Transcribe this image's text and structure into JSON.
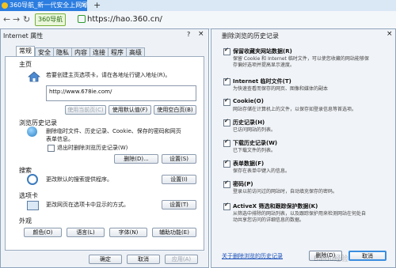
{
  "browser": {
    "tab_title": "360导航_新一代安全上网导航",
    "tab_close": "×",
    "new_tab": "+",
    "nav_back": "←",
    "nav_forward": "→",
    "nav_refresh": "↻",
    "tag_label": "360导航",
    "url": "https://hao.360.cn/"
  },
  "internet_options": {
    "title": "Internet 属性",
    "help": "?",
    "close": "×",
    "tabs": [
      "常规",
      "安全",
      "隐私",
      "内容",
      "连接",
      "程序",
      "高级"
    ],
    "home": {
      "section": "主页",
      "desc": "若要创建主页选项卡，请在各地址行键入地址(R)。",
      "value": "http://www.678ie.com/",
      "btn_current": "使用当前页(C)",
      "btn_default": "使用默认值(F)",
      "btn_blank": "使用空白页(B)"
    },
    "history": {
      "section": "浏览历史记录",
      "desc1": "删除临时文件、历史记录、Cookie、保存的密码和网页",
      "desc2": "表单信息。",
      "checkbox": "退出时删除浏览历史记录(W)",
      "btn_delete": "删除(D)...",
      "btn_settings": "设置(S)"
    },
    "search": {
      "section": "搜索",
      "desc": "更改默认的搜索提供程序。",
      "btn": "设置(I)"
    },
    "tabs_section": {
      "section": "选项卡",
      "desc": "更改网页在选项卡中显示的方式。",
      "btn": "设置(T)"
    },
    "appearance": {
      "section": "外观",
      "colors": "颜色(O)",
      "languages": "语言(L)",
      "fonts": "字体(N)",
      "accessibility": "辅助功能(E)"
    },
    "footer": {
      "ok": "确定",
      "cancel": "取消",
      "apply": "应用(A)"
    }
  },
  "delete_history": {
    "title": "删除浏览的历史记录",
    "close": "×",
    "items": [
      {
        "label": "保留收藏夹网站数据(R)",
        "desc1": "保留 Cookie 和 Internet 临时文件，可以使您收藏的网站能够保",
        "desc2": "存偏好选项并提高显示速度。",
        "checked": true
      },
      {
        "label": "Internet 临时文件(T)",
        "desc1": "为快速查看而保存的网页、图像和媒体的副本",
        "desc2": "",
        "checked": true
      },
      {
        "label": "Cookie(O)",
        "desc1": "网站存储在计算机上的文件，以保存如登录信息等首选项。",
        "desc2": "",
        "checked": true
      },
      {
        "label": "历史记录(H)",
        "desc1": "已访问网站的列表。",
        "desc2": "",
        "checked": true
      },
      {
        "label": "下载历史记录(W)",
        "desc1": "已下载文件的列表。",
        "desc2": "",
        "checked": true
      },
      {
        "label": "表单数据(F)",
        "desc1": "保存在表单中键入的信息。",
        "desc2": "",
        "checked": true
      },
      {
        "label": "密码(P)",
        "desc1": "登录以前访问过的网站时，自动填充保存的密码。",
        "desc2": "",
        "checked": true
      },
      {
        "label": "ActiveX 筛选和跟踪保护数据(K)",
        "desc1": "从筛选中排除的网站列表，以及跟踪保护用来检测网站在何处自",
        "desc2": "动共享您访问的详细信息的数据。",
        "checked": true
      }
    ],
    "link": "关于删除浏览的历史记录",
    "btn_delete": "删除(D)",
    "btn_cancel": "取消"
  },
  "watermark": "Baidu经验"
}
